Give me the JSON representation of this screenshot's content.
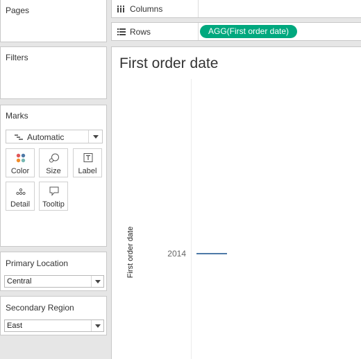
{
  "cards": {
    "pages": {
      "title": "Pages"
    },
    "filters": {
      "title": "Filters"
    },
    "marks": {
      "title": "Marks",
      "mark_type": {
        "value": "Automatic",
        "icon": "automatic-mark-icon"
      },
      "buttons": [
        {
          "label": "Color",
          "icon": "color-dots-icon"
        },
        {
          "label": "Size",
          "icon": "size-shapes-icon"
        },
        {
          "label": "Label",
          "icon": "label-t-icon"
        },
        {
          "label": "Detail",
          "icon": "detail-dots-icon"
        },
        {
          "label": "Tooltip",
          "icon": "tooltip-bubble-icon"
        }
      ]
    },
    "primary_location": {
      "title": "Primary Location",
      "value": "Central"
    },
    "secondary_region": {
      "title": "Secondary Region",
      "value": "East"
    }
  },
  "shelves": {
    "columns": {
      "label": "Columns",
      "icon": "columns-icon",
      "pills": []
    },
    "rows": {
      "label": "Rows",
      "icon": "rows-icon",
      "pills": [
        "AGG(First order date)"
      ]
    }
  },
  "viz": {
    "title": "First order date",
    "colors": {
      "pill": "#00a87e",
      "mark": "#4e79a7"
    }
  },
  "chart_data": {
    "type": "line",
    "title": "First order date",
    "ylabel": "First order date",
    "xlabel": "",
    "y_tick_labels": [
      "2014"
    ],
    "series": [
      {
        "values": [
          2014
        ]
      }
    ],
    "grid": false
  }
}
